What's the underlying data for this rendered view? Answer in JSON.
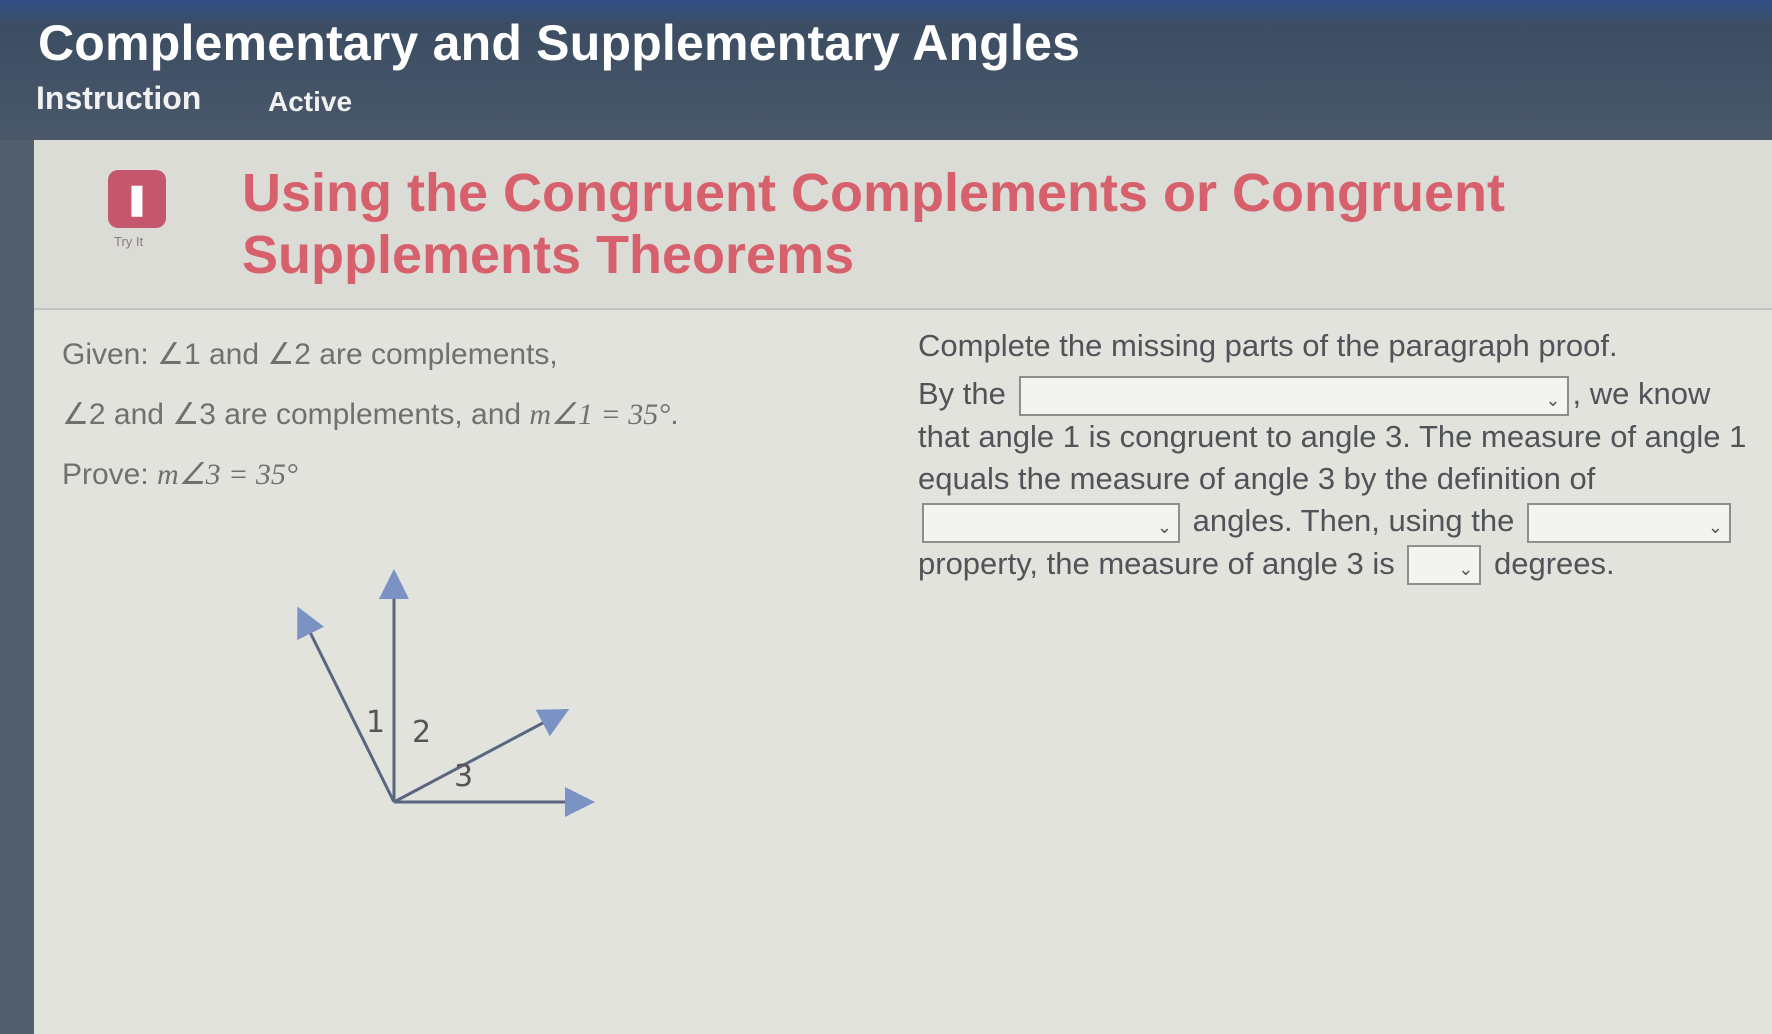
{
  "app": {
    "title": "Complementary and Supplementary Angles",
    "tabs": [
      {
        "label": "Instruction"
      }
    ],
    "status": "Active"
  },
  "lesson": {
    "icon_label": "Try It",
    "icon_name": "try-it-icon",
    "title": "Using the Congruent Complements or Congruent Supplements Theorems"
  },
  "given": {
    "line1": {
      "pre": "Given: ",
      "a1": "∠1",
      "mid": " and ",
      "a2": "∠2",
      "post": " are complements,"
    },
    "line2": {
      "a1": "∠2",
      "mid": " and ",
      "a2": "∠3",
      "mid2": " are complements, and ",
      "expr": "m∠1 = 35°",
      "end": "."
    },
    "line3": {
      "pre": "Prove: ",
      "expr": "m∠3 = 35°"
    }
  },
  "diagram": {
    "labels": {
      "angle1": "1",
      "angle2": "2",
      "angle3": "3"
    },
    "ray_color": "#7b92c4",
    "line_color": "#5a6580"
  },
  "proof": {
    "instructions": "Complete the missing parts of the paragraph proof.",
    "t1": "By the",
    "t2": ", we know that angle 1 is congruent to angle 3. The measure of angle 1 equals the measure of angle 3 by the definition of",
    "t3": "angles. Then, using the",
    "t4": "property, the measure of angle 3 is",
    "t5": "degrees.",
    "dropdowns": [
      {
        "selected": ""
      },
      {
        "selected": ""
      },
      {
        "selected": ""
      },
      {
        "selected": ""
      }
    ]
  },
  "colors": {
    "title_accent": "#d6606b",
    "header_bar": "#3c4d63",
    "card_bg": "#e3e3de"
  }
}
